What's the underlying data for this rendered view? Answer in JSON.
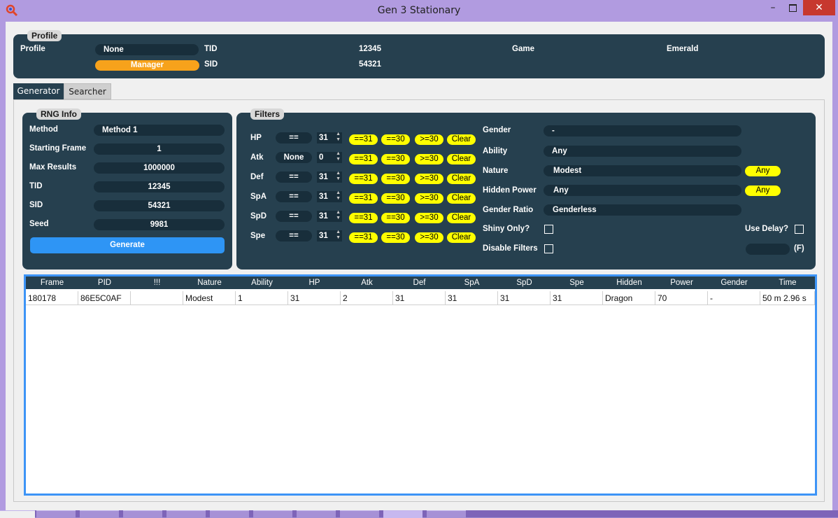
{
  "window": {
    "title": "Gen 3 Stationary"
  },
  "profile": {
    "group_title": "Profile",
    "label": "Profile",
    "value": "None",
    "manager_label": "Manager",
    "tid_label": "TID",
    "tid": "12345",
    "sid_label": "SID",
    "sid": "54321",
    "game_label": "Game",
    "game": "Emerald"
  },
  "tabs": [
    "Generator",
    "Searcher"
  ],
  "rng_info": {
    "group_title": "RNG Info",
    "method_label": "Method",
    "method": "Method 1",
    "start_label": "Starting Frame",
    "start": "1",
    "max_label": "Max Results",
    "max": "1000000",
    "tid_label": "TID",
    "tid": "12345",
    "sid_label": "SID",
    "sid": "54321",
    "seed_label": "Seed",
    "seed": "9981",
    "generate_label": "Generate"
  },
  "filters": {
    "group_title": "Filters",
    "stats": [
      {
        "label": "HP",
        "compare": "==",
        "value": "31"
      },
      {
        "label": "Atk",
        "compare": "None",
        "value": "0"
      },
      {
        "label": "Def",
        "compare": "==",
        "value": "31"
      },
      {
        "label": "SpA",
        "compare": "==",
        "value": "31"
      },
      {
        "label": "SpD",
        "compare": "==",
        "value": "31"
      },
      {
        "label": "Spe",
        "compare": "==",
        "value": "31"
      }
    ],
    "quick_buttons": [
      "==31",
      "==30",
      ">=30",
      "Clear"
    ],
    "gender_label": "Gender",
    "gender": "-",
    "ability_label": "Ability",
    "ability": "Any",
    "nature_label": "Nature",
    "nature": "Modest",
    "nature_any": "Any",
    "hp_label": "Hidden Power",
    "hidden_power": "Any",
    "hp_any": "Any",
    "ratio_label": "Gender Ratio",
    "ratio": "Genderless",
    "shiny_label": "Shiny Only?",
    "disable_label": "Disable Filters",
    "delay_label": "Use Delay?",
    "delay_value": "",
    "delay_unit": "(F)"
  },
  "results": {
    "columns": [
      "Frame",
      "PID",
      "!!!",
      "Nature",
      "Ability",
      "HP",
      "Atk",
      "Def",
      "SpA",
      "SpD",
      "Spe",
      "Hidden",
      "Power",
      "Gender",
      "Time"
    ],
    "rows": [
      [
        "180178",
        "86E5C0AF",
        "",
        "Modest",
        "1",
        "31",
        "2",
        "31",
        "31",
        "31",
        "31",
        "Dragon",
        "70",
        "-",
        "50 m 2.96 s"
      ]
    ]
  }
}
